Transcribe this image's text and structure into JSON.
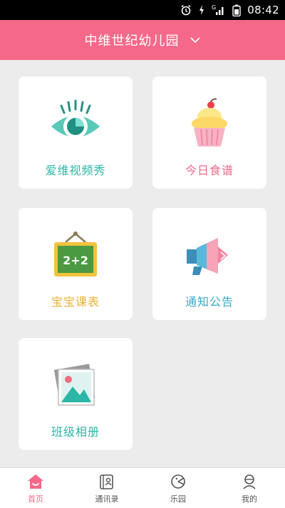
{
  "status_bar": {
    "time": "08:42",
    "signal_label": "G"
  },
  "header": {
    "title": "中维世纪幼儿园"
  },
  "cards": {
    "video": {
      "label": "爱维视频秀",
      "color": "#2bb6a7"
    },
    "menu": {
      "label": "今日食谱",
      "color": "#f06a8a"
    },
    "schedule": {
      "label": "宝宝课表",
      "color": "#e8b23a"
    },
    "notice": {
      "label": "通知公告",
      "color": "#3aa9c6"
    },
    "album": {
      "label": "班级相册",
      "color": "#2bb6a7"
    }
  },
  "bottom_nav": {
    "items": [
      {
        "label": "首页",
        "icon": "home-icon",
        "active": true
      },
      {
        "label": "通讯录",
        "icon": "contacts-icon",
        "active": false
      },
      {
        "label": "乐园",
        "icon": "playground-icon",
        "active": false
      },
      {
        "label": "我的",
        "icon": "profile-icon",
        "active": false
      }
    ]
  },
  "colors": {
    "accent": "#f4698a",
    "background": "#ececec"
  }
}
